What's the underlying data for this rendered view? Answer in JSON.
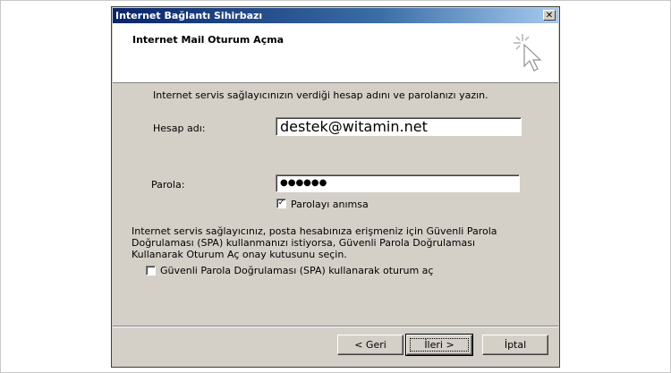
{
  "window": {
    "title": "Internet Bağlantı Sihirbazı",
    "close_glyph": "✕"
  },
  "header": {
    "title": "Internet Mail Oturum Açma",
    "icon": "wizard-cursor-icon"
  },
  "body": {
    "instruction": "Internet servis sağlayıcınızın verdiği hesap adını ve parolanızı yazın.",
    "account_label": "Hesap adı:",
    "account_value": "destek@witamin.net",
    "password_label": "Parola:",
    "password_value": "●●●●●●",
    "remember_label": "Parolayı anımsa",
    "remember_checked": "✓",
    "spa_paragraph": "Internet servis sağlayıcınız, posta hesabınıza erişmeniz için Güvenli Parola Doğrulaması (SPA) kullanmanızı istiyorsa, Güvenli Parola Doğrulaması Kullanarak Oturum Aç onay kutusunu seçin.",
    "spa_label": "Güvenli Parola Doğrulaması (SPA) kullanarak oturum aç",
    "spa_checked": ""
  },
  "buttons": {
    "back": "< Geri",
    "next": "İleri >",
    "cancel": "İptal"
  },
  "colors": {
    "dialog_bg": "#d4d0c8",
    "title_start": "#0a246a",
    "title_end": "#a6caf0"
  }
}
